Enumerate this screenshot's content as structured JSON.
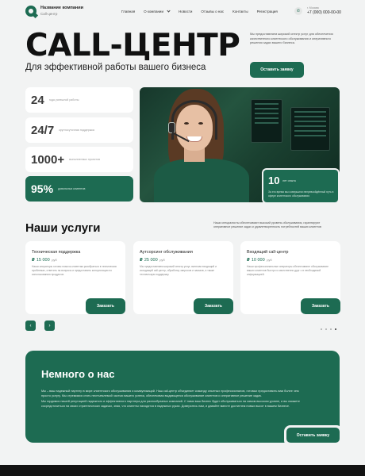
{
  "header": {
    "brand_name": "Название компании",
    "brand_sub": "Call-центр",
    "nav": [
      {
        "label": "Главная"
      },
      {
        "label": "О компании"
      },
      {
        "label": "Новости"
      },
      {
        "label": "Отзывы о нас"
      },
      {
        "label": "Контакты"
      },
      {
        "label": "Регистрация"
      }
    ],
    "phone_caption": "г. Москва",
    "phone": "+7 (000) 000-00-00"
  },
  "hero": {
    "title": "CALL-ЦЕНТР",
    "subtitle": "Для эффективной работы вашего бизнеса",
    "description": "Мы предоставляем широкий спектр услуг для обеспечения качественного клиентского обслуживания и оперативного решения задач вашего бизнеса.",
    "cta": "Оставить заявку"
  },
  "stats": [
    {
      "value": "24",
      "label": "года успешной работы"
    },
    {
      "value": "24/7",
      "label": "круглосуточная поддержка"
    },
    {
      "value": "1000+",
      "label": "выполненных проектов"
    },
    {
      "value": "95%",
      "label": "довольных клиентов"
    }
  ],
  "experience": {
    "value": "10",
    "label": "лет опыта",
    "description": "За это время мы совершили непревзойдённый путь в сфере клиентского обслуживания"
  },
  "services": {
    "title": "Наши услуги",
    "description": "Наши специалисты обеспечивают высокий уровень обслуживания, гарантируют оперативное решение задач и удовлетворенность потребностей ваших клиентов",
    "cards": [
      {
        "title": "Техническая поддержка",
        "currency": "₽",
        "price": "15 000",
        "unit": "руб",
        "text": "Наши операторы готовы помочь клиентам разобраться в технических проблемах, ответить на вопросы и предоставить консультации по использованию продуктов.",
        "button": "Заказать"
      },
      {
        "title": "Аутсорсинг обслуживания",
        "currency": "₽",
        "price": "25 000",
        "unit": "руб",
        "text": "Мы предоставляем широкий спектр услуг, включая входящий и исходящий call-центр, обработку запросов и заказов, а также техническую поддержку.",
        "button": "Заказать"
      },
      {
        "title": "Входящий call-центр",
        "currency": "₽",
        "price": "10 000",
        "unit": "руб",
        "text": "Наши профессиональные операторы обеспечивают обслуживание ваших клиентов быстро и качественно друг с в необходимой информацией.",
        "button": "Заказать"
      }
    ],
    "prev_icon": "chevron-left-icon",
    "next_icon": "chevron-right-icon",
    "prev_glyph": "‹",
    "next_glyph": "›"
  },
  "about": {
    "title": "Немного о нас",
    "paragraphs": [
      "Мы – ваш надежный партнер в мире клиентского обслуживания и коммуникаций. Наш call-центр объединяет команду опытных профессионалов, готовых предоставить вам более чем просто услугу. Мы стремимся стать неотъемлемой частью вашего успеха, обеспечивая выдающееся обслуживание клиентов и оперативное решение задач.",
      "Мы гордимся нашей репутацией надежного и эффективного партнера для разнообразных компаний. С нами ваш бизнес будет обслуживаться на самом высоком уровне, и вы сможете сосредоточиться на своих стратегических задачах, зная, что клиенты находятся в надежных руках. Доверьтесь нам, и давайте вместе достигнем новых высот в вашем бизнесе."
    ],
    "cta": "Оставить заявку"
  },
  "colors": {
    "accent": "#1d6b52",
    "background": "#f2f3f3",
    "footer": "#131313"
  }
}
